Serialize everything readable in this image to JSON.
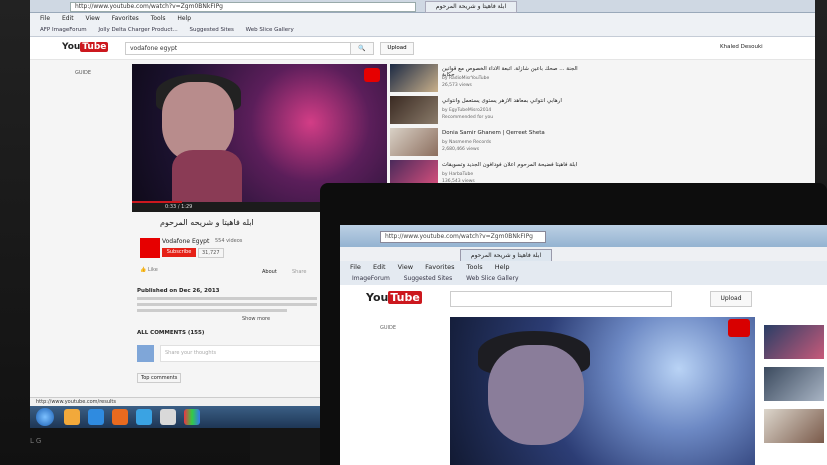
{
  "back_browser": {
    "url": "http://www.youtube.com/watch?v=Zgm0BNkFIPg",
    "tab_title": "ابلة فاهيتا و شريحة المرحوم",
    "menu": [
      "File",
      "Edit",
      "View",
      "Favorites",
      "Tools",
      "Help"
    ],
    "favorites": [
      "AFP ImageForum",
      "Jolly Delta Charger Product...",
      "Suggested Sites",
      "Web Slice Gallery"
    ],
    "status_url": "http://www.youtube.com/results"
  },
  "youtube": {
    "search_query": "vodafone egypt",
    "upload_label": "Upload",
    "user_name": "Khaled Desouki",
    "guide_label": "GUIDE",
    "video": {
      "title": "ابله فاهيتا و شريحه المرحوم",
      "time": "0:33 / 1:29",
      "channel": "Vodafone Egypt",
      "video_count": "554 videos",
      "subscribe_label": "Subscribe",
      "subscriber_count": "31,727",
      "like_label": "Like",
      "about_label": "About",
      "share_label": "Share",
      "published": "Published on Dec 26, 2013",
      "show_more": "Show more",
      "comments_header": "ALL COMMENTS (155)",
      "comment_placeholder": "Share your thoughts",
      "top_comments": "Top comments"
    },
    "recommendations": [
      {
        "title": "الجنة ... صحك باعين شازلة. اتبعة الاداء الخصوص مع قوانين حكاية",
        "channel": "by RadioMisrYouTube",
        "views": "26,573 views"
      },
      {
        "title": "ارهابي انتواني بمعاهد الازهر يستوى يستعمل وانتواني",
        "channel": "by EgyTubeMisro2014",
        "views": "Recommended for you"
      },
      {
        "title": "Donia Samir Ghanem | Qerreet Sheta",
        "channel": "by Nasmeme Records",
        "views": "2,680,466 views"
      },
      {
        "title": "ابلة فاهيتا فضيحة المرحوم اعلان فودافون الجديد وتسويقات",
        "channel": "by HarbaTube",
        "views": "136,543 views"
      }
    ]
  },
  "laptop_browser": {
    "menu": [
      "File",
      "Edit",
      "View",
      "Favorites",
      "Tools",
      "Help"
    ],
    "favorites": [
      "ImageForum",
      "Suggested Sites",
      "Web Slice Gallery"
    ],
    "guide_label": "GUIDE",
    "upload_label": "Upload"
  },
  "monitor_brand": "LG"
}
